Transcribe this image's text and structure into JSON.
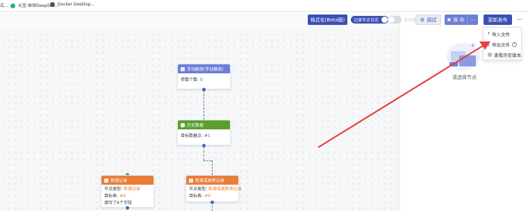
{
  "bookmarks": [
    {
      "label": "式…",
      "icon": "bookmark-icon"
    },
    {
      "label": "元宝-体验DeepSee...",
      "icon": "yuanbao-icon"
    },
    {
      "label": "Docker Desktop...",
      "icon": "docker-icon"
    }
  ],
  "toolbar": {
    "format_label": "格式化(Beta版)",
    "record_log_label": "记录节点日志",
    "auto_save_label": "自动保存",
    "debug_label": "调试",
    "save_label": "保 存",
    "more_label": "···",
    "publish_label": "更新发布",
    "overflow_label": "···"
  },
  "dropdown": {
    "items": [
      {
        "label": "导入文件",
        "icon": "upload-icon"
      },
      {
        "label": "导出文件",
        "icon": "download-icon",
        "help": "?"
      },
      {
        "label": "查看历史版本",
        "icon": "history-icon"
      }
    ]
  },
  "right_panel": {
    "empty_text": "请选择节点"
  },
  "nodes": {
    "manual": {
      "title": "手动触发(手动触发)",
      "rows": [
        {
          "label": "参数个数:",
          "value": "0"
        }
      ],
      "color": "#6b7fd7"
    },
    "history": {
      "title": "历史数据",
      "rows": [
        {
          "label": "目标数据点:",
          "value": "#1"
        }
      ],
      "color": "#5a9e2f"
    },
    "add_record": {
      "title": "新增记录",
      "rows": [
        {
          "label": "节点类型:",
          "value": "新增记录"
        },
        {
          "label": "目标表:",
          "value": "#9"
        },
        {
          "label": "填写了6个字段",
          "value": ""
        }
      ],
      "color": "#ea7d3a"
    },
    "add_or_update": {
      "title": "新增或更新记录",
      "rows": [
        {
          "label": "节点类型:",
          "value": "新增或更新表记录"
        },
        {
          "label": "目标表:",
          "value": "#9"
        }
      ],
      "color": "#ea7d3a"
    }
  },
  "colors": {
    "primary": "#3b4fb4",
    "save": "#6b7fd7",
    "annotation_arrow": "#e5403a"
  }
}
